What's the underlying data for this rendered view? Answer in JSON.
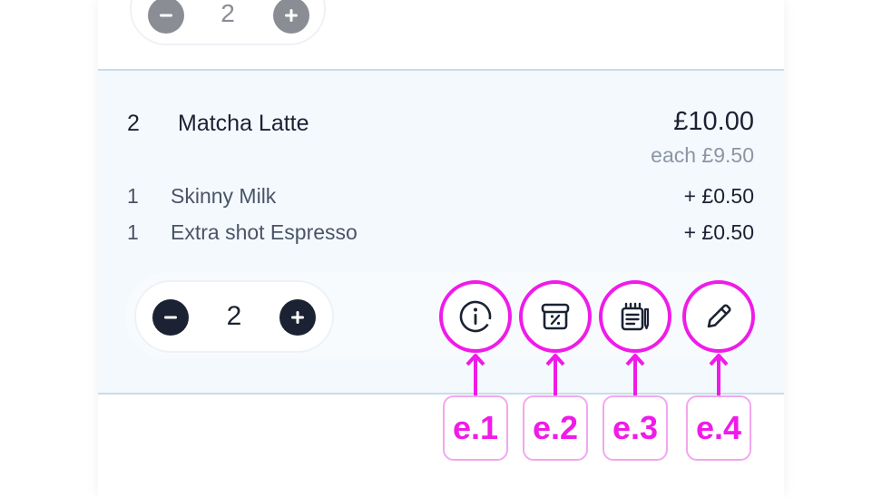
{
  "previous_item": {
    "quantity": "2"
  },
  "item": {
    "quantity": "2",
    "name": "Matcha Latte",
    "total_price": "£10.00",
    "each_price": "each £9.50",
    "modifiers": [
      {
        "quantity": "1",
        "name": "Skinny Milk",
        "price": "+ £0.50"
      },
      {
        "quantity": "1",
        "name": "Extra shot Espresso",
        "price": "+ £0.50"
      }
    ],
    "stepper_quantity": "2"
  },
  "annotations": {
    "labels": [
      "e.1",
      "e.2",
      "e.3",
      "e.4"
    ],
    "color": "#f01be8"
  },
  "icons": [
    "info-icon",
    "discount-icon",
    "notes-icon",
    "edit-icon"
  ]
}
